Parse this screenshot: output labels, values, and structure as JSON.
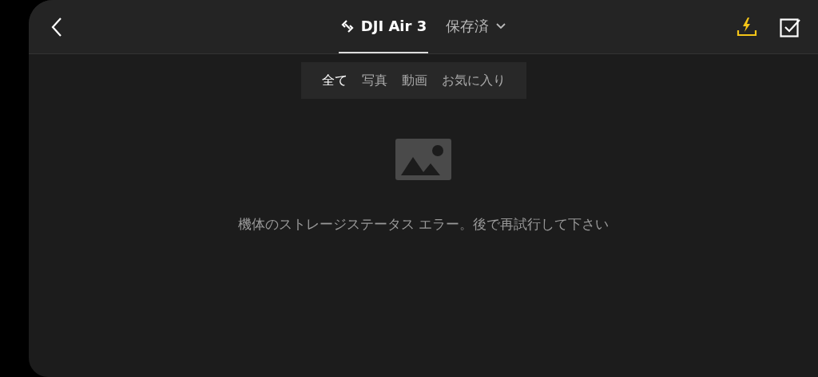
{
  "header": {
    "tabs": [
      {
        "label": "DJI Air 3",
        "kind": "device",
        "selected": true
      },
      {
        "label": "保存済",
        "kind": "dropdown",
        "selected": false
      }
    ]
  },
  "filters": [
    {
      "label": "全て",
      "selected": true
    },
    {
      "label": "写真",
      "selected": false
    },
    {
      "label": "動画",
      "selected": false
    },
    {
      "label": "お気に入り",
      "selected": false
    }
  ],
  "empty_state": {
    "message": "機体のストレージステータス エラー。後で再試行して下さい"
  }
}
